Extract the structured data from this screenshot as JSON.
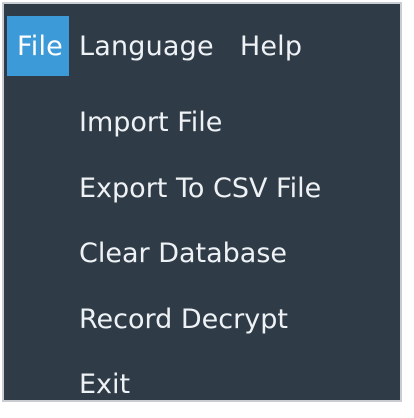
{
  "menubar": {
    "items": [
      {
        "label": "File"
      },
      {
        "label": "Language"
      },
      {
        "label": "Help"
      }
    ]
  },
  "file_menu": {
    "items": [
      {
        "label": "Import File"
      },
      {
        "label": "Export To CSV File"
      },
      {
        "label": "Clear Database"
      },
      {
        "label": "Record Decrypt"
      },
      {
        "label": "Exit"
      }
    ]
  },
  "colors": {
    "background": "#2f3b47",
    "highlight": "#3d9ad9",
    "text": "#eef2f5",
    "border": "#c9ccd0"
  }
}
